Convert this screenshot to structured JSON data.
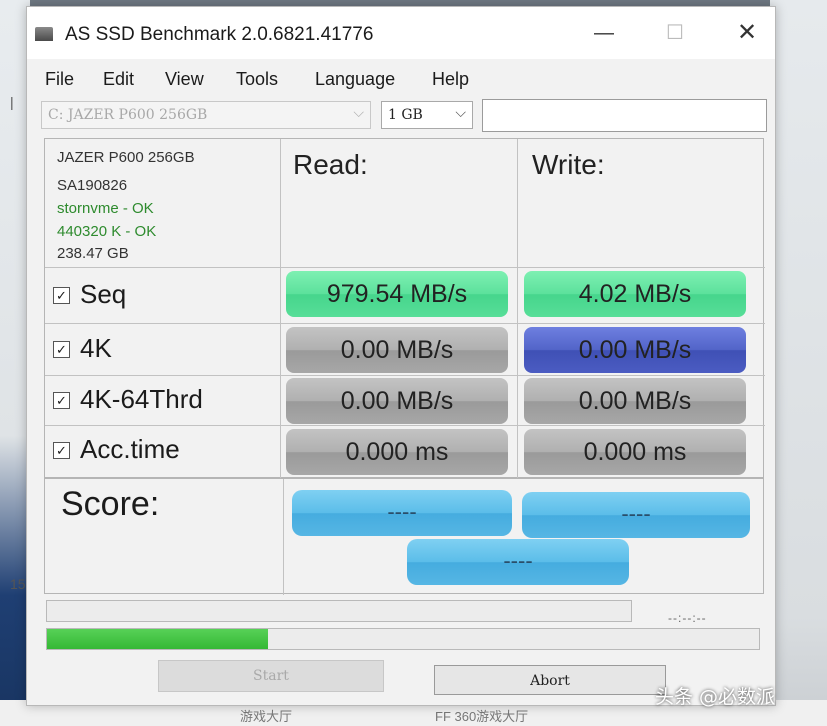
{
  "window": {
    "title": "AS SSD Benchmark 2.0.6821.41776",
    "controls": {
      "minimize": "—",
      "maximize": "☐",
      "close": "✕"
    }
  },
  "menu": [
    "File",
    "Edit",
    "View",
    "Tools",
    "Language",
    "Help"
  ],
  "toolbar": {
    "drive_value": "C: JAZER P600 256GB",
    "size_value": "1 GB"
  },
  "drive_info": {
    "model": "JAZER P600 256GB",
    "firmware": "SA190826",
    "driver": "stornvme - OK",
    "alignment": "440320 K - OK",
    "capacity": "238.47 GB"
  },
  "headers": {
    "read": "Read:",
    "write": "Write:"
  },
  "tests": [
    {
      "label": "Seq",
      "checked": true,
      "read": "979.54 MB/s",
      "write": "4.02 MB/s"
    },
    {
      "label": "4K",
      "checked": true,
      "read": "0.00 MB/s",
      "write": "0.00 MB/s"
    },
    {
      "label": "4K-64Thrd",
      "checked": true,
      "read": "0.00 MB/s",
      "write": "0.00 MB/s"
    },
    {
      "label": "Acc.time",
      "checked": true,
      "read": "0.000 ms",
      "write": "0.000 ms"
    }
  ],
  "score": {
    "label": "Score:",
    "read": "----",
    "write": "----",
    "total": "----"
  },
  "progress": {
    "elapsed": "--:--:--",
    "overall_fraction": 0.31
  },
  "buttons": {
    "start": "Start",
    "abort": "Abort"
  },
  "colors": {
    "seq_cell": "#5ce19c",
    "active_cell": "#5264c8",
    "idle_cell": "#b0b0b0",
    "score_pill": "#5bbde9",
    "progress_fill": "#35b835",
    "ok_text": "#2e8b2e"
  },
  "watermark": "头条 @必数派",
  "background": {
    "left_labels": [
      "15"
    ],
    "bottom_texts": [
      "游戏大厅",
      "FF 360游戏大厅"
    ]
  }
}
